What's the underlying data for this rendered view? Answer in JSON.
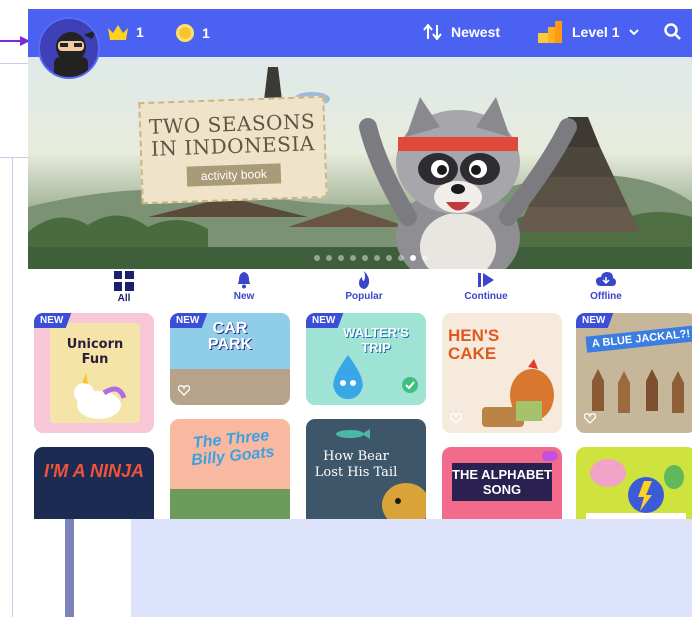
{
  "header": {
    "crowns": "1",
    "coins": "1",
    "sort_label": "Newest",
    "level_label": "Level 1"
  },
  "hero": {
    "title_line1": "TWO SEASONS",
    "title_line2": "IN INDONESIA",
    "subtitle": "activity book",
    "slide_count": 10,
    "active_slide": 8
  },
  "categories": [
    {
      "label": "All",
      "icon": "grid-icon"
    },
    {
      "label": "New",
      "icon": "bell-icon"
    },
    {
      "label": "Popular",
      "icon": "flame-icon"
    },
    {
      "label": "Continue",
      "icon": "play-icon"
    },
    {
      "label": "Offline",
      "icon": "cloud-download-icon"
    }
  ],
  "books": [
    {
      "title": "Unicorn Fun",
      "badge": "NEW"
    },
    {
      "title": "CAR PARK",
      "badge": "NEW"
    },
    {
      "title": "WALTER'S TRIP",
      "badge": "NEW"
    },
    {
      "title": "HEN'S CAKE",
      "badge": ""
    },
    {
      "title": "A BLUE JACKAL?!",
      "badge": "NEW"
    },
    {
      "title": "I'M A NINJA",
      "badge": ""
    },
    {
      "title": "The Three Billy Goats",
      "badge": ""
    },
    {
      "title": "How Bear Lost His Tail",
      "badge": ""
    },
    {
      "title": "THE ALPHABET SONG",
      "badge": ""
    },
    {
      "title": "",
      "badge": ""
    }
  ],
  "colors": {
    "brand": "#4a61f2",
    "badge": "#3b4ed8",
    "coin": "#f8c531",
    "crown": "#ffd21f"
  }
}
